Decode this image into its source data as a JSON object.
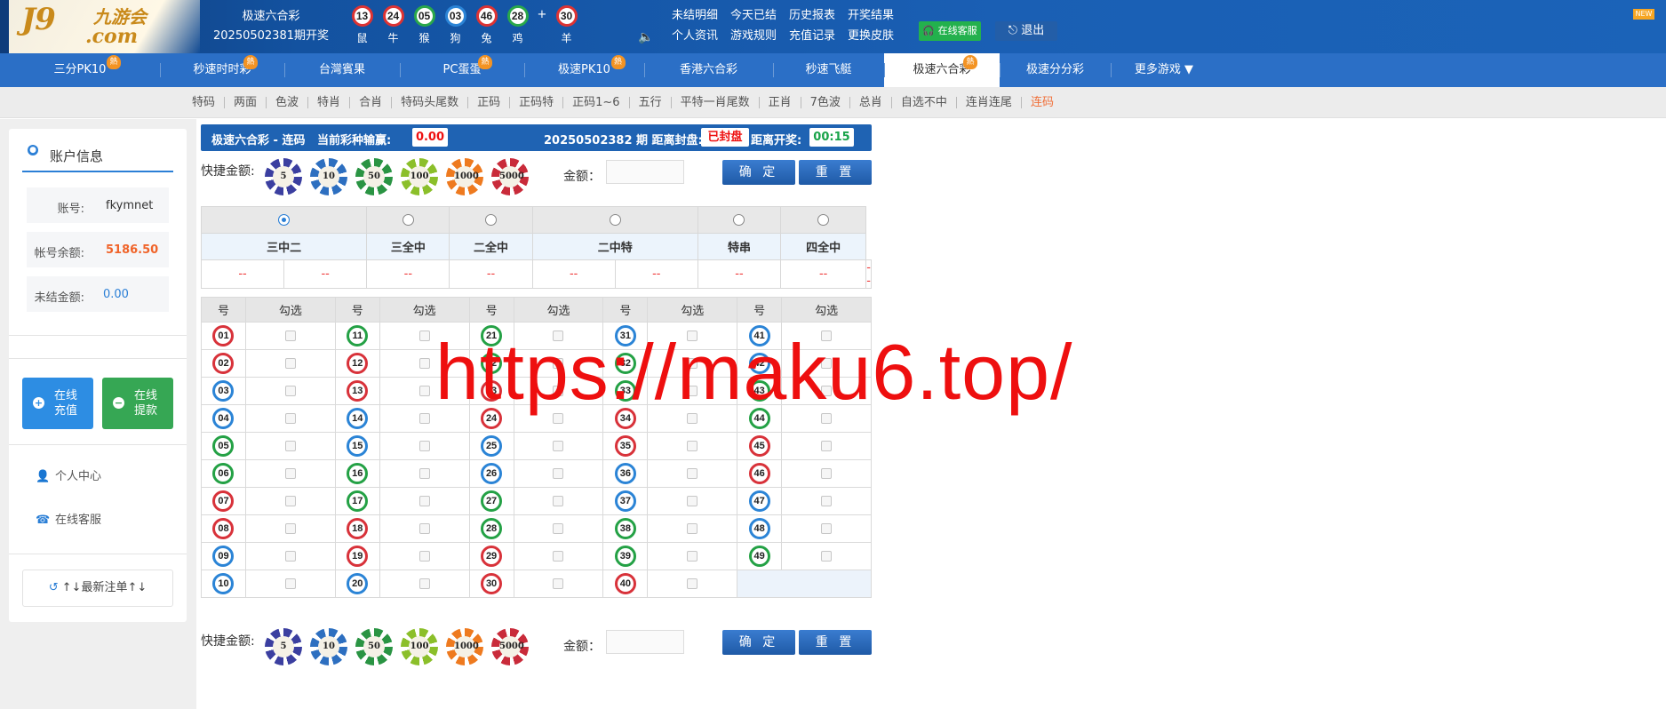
{
  "header": {
    "logo_text": "J9",
    "logo_sub": "九游会",
    "logo_com": ".com",
    "lottery_name": "极速六合彩",
    "period_label": "20250502381期开奖",
    "draw_balls": [
      {
        "num": "13",
        "zodiac": "鼠",
        "color": "red"
      },
      {
        "num": "24",
        "zodiac": "牛",
        "color": "red"
      },
      {
        "num": "05",
        "zodiac": "猴",
        "color": "green"
      },
      {
        "num": "03",
        "zodiac": "狗",
        "color": "blue"
      },
      {
        "num": "46",
        "zodiac": "兔",
        "color": "red"
      },
      {
        "num": "28",
        "zodiac": "鸡",
        "color": "green"
      }
    ],
    "plus": "+",
    "special_ball": {
      "num": "30",
      "zodiac": "羊",
      "color": "red"
    },
    "links": [
      "未结明细",
      "今天已结",
      "历史报表",
      "开奖结果",
      "个人资讯",
      "游戏规则",
      "充值记录",
      "更换皮肤"
    ],
    "service_label": "在线客服",
    "logout_label": "退出",
    "new_badge": "NEW"
  },
  "nav": {
    "items": [
      {
        "label": "三分PK10",
        "hot": true
      },
      {
        "label": "秒速时时彩",
        "hot": true
      },
      {
        "label": "台灣賓果",
        "hot": false
      },
      {
        "label": "PC蛋蛋",
        "hot": true
      },
      {
        "label": "极速PK10",
        "hot": true
      },
      {
        "label": "香港六合彩",
        "hot": false
      },
      {
        "label": "秒速飞艇",
        "hot": false
      },
      {
        "label": "极速六合彩",
        "hot": true,
        "active": true
      },
      {
        "label": "极速分分彩",
        "hot": false
      },
      {
        "label": "更多游戏 ▼",
        "hot": false
      }
    ],
    "hot_label": "熱"
  },
  "subnav": {
    "items": [
      "特码",
      "两面",
      "色波",
      "特肖",
      "合肖",
      "特码头尾数",
      "正码",
      "正码特",
      "正码1~6",
      "五行",
      "平特一肖尾数",
      "正肖",
      "7色波",
      "总肖",
      "自选不中",
      "连肖连尾",
      "连码"
    ],
    "active": "连码"
  },
  "account": {
    "title": "账户信息",
    "account_label": "账号:",
    "account_value": "fkymnet",
    "balance_label": "帐号余额:",
    "balance_value": "5186.50",
    "unsettled_label": "未结金额:",
    "unsettled_value": "0.00",
    "deposit_label": "在线\n充值",
    "withdraw_label": "在线\n提款",
    "personal_center": "个人中心",
    "online_service": "在线客服",
    "recent_bets": "↑↓最新注单↑↓"
  },
  "infobar": {
    "game_title": "极速六合彩 - 连码",
    "profit_label": "当前彩种输赢:",
    "profit_value": "0.00",
    "period_text": "20250502382 期 距离封盘:",
    "closed_label": "已封盘",
    "draw_label": "距离开奖:",
    "timer": "00:15"
  },
  "quickbet": {
    "label": "快捷金额:",
    "chips": [
      "5",
      "10",
      "50",
      "100",
      "1000",
      "5000"
    ],
    "amount_label": "金额：",
    "amount_value": "",
    "confirm_label": "确 定",
    "reset_label": "重 置"
  },
  "play_types": {
    "names": [
      "三中二",
      "三全中",
      "二全中",
      "二中特",
      "特串",
      "四全中"
    ],
    "odds": [
      "--",
      "--",
      "--",
      "--",
      "--",
      "--",
      "--",
      "--",
      "--"
    ],
    "selected_index": 0
  },
  "number_table": {
    "header_num": "号",
    "header_check": "勾选",
    "numbers": [
      [
        "01",
        "red"
      ],
      [
        "02",
        "red"
      ],
      [
        "03",
        "blue"
      ],
      [
        "04",
        "blue"
      ],
      [
        "05",
        "green"
      ],
      [
        "06",
        "green"
      ],
      [
        "07",
        "red"
      ],
      [
        "08",
        "red"
      ],
      [
        "09",
        "blue"
      ],
      [
        "10",
        "blue"
      ],
      [
        "11",
        "green"
      ],
      [
        "12",
        "red"
      ],
      [
        "13",
        "red"
      ],
      [
        "14",
        "blue"
      ],
      [
        "15",
        "blue"
      ],
      [
        "16",
        "green"
      ],
      [
        "17",
        "green"
      ],
      [
        "18",
        "red"
      ],
      [
        "19",
        "red"
      ],
      [
        "20",
        "blue"
      ],
      [
        "21",
        "green"
      ],
      [
        "22",
        "green"
      ],
      [
        "23",
        "red"
      ],
      [
        "24",
        "red"
      ],
      [
        "25",
        "blue"
      ],
      [
        "26",
        "blue"
      ],
      [
        "27",
        "green"
      ],
      [
        "28",
        "green"
      ],
      [
        "29",
        "red"
      ],
      [
        "30",
        "red"
      ],
      [
        "31",
        "blue"
      ],
      [
        "32",
        "green"
      ],
      [
        "33",
        "green"
      ],
      [
        "34",
        "red"
      ],
      [
        "35",
        "red"
      ],
      [
        "36",
        "blue"
      ],
      [
        "37",
        "blue"
      ],
      [
        "38",
        "green"
      ],
      [
        "39",
        "green"
      ],
      [
        "40",
        "red"
      ],
      [
        "41",
        "blue"
      ],
      [
        "42",
        "blue"
      ],
      [
        "43",
        "green"
      ],
      [
        "44",
        "green"
      ],
      [
        "45",
        "red"
      ],
      [
        "46",
        "red"
      ],
      [
        "47",
        "blue"
      ],
      [
        "48",
        "blue"
      ],
      [
        "49",
        "green"
      ]
    ]
  },
  "watermark": "https://maku6.top/"
}
